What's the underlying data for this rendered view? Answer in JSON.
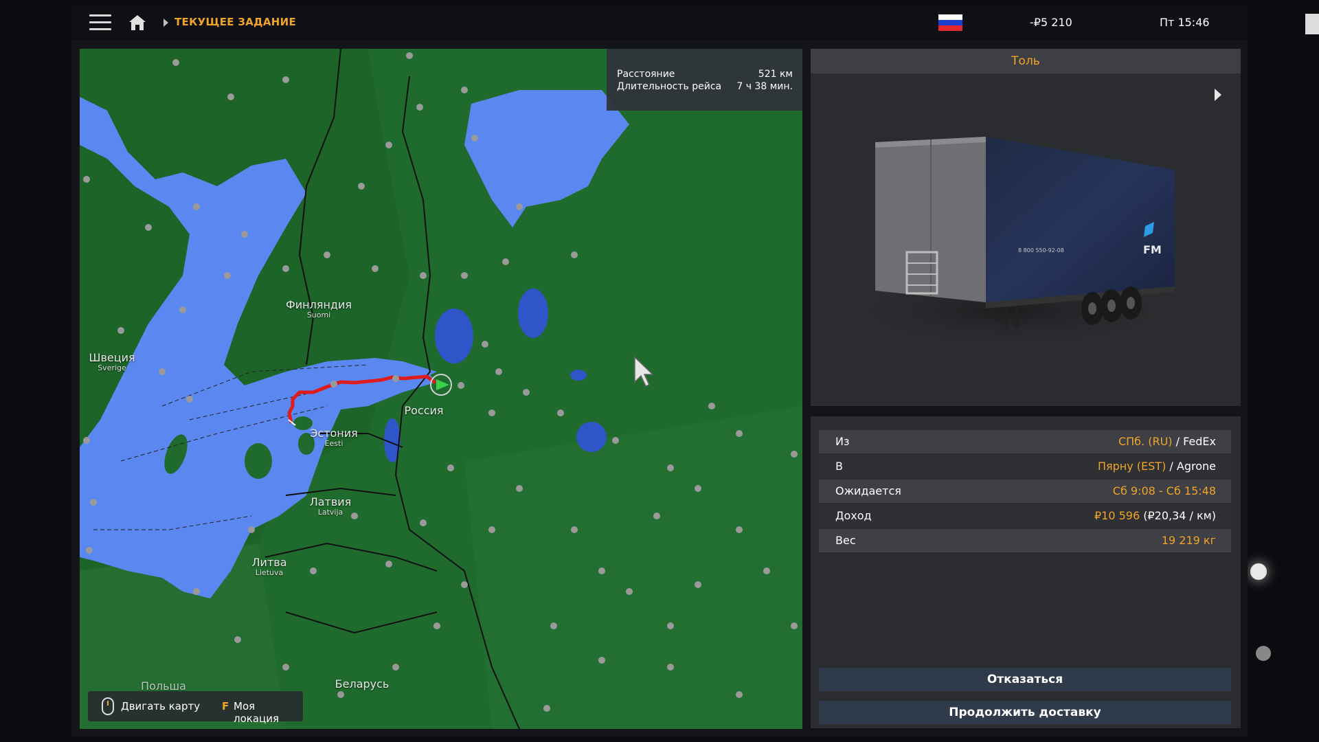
{
  "topbar": {
    "breadcrumb": "ТЕКУЩЕЕ ЗАДАНИЕ",
    "money": "-₽5 210",
    "clock": "Пт 15:46",
    "flag": {
      "colors": [
        "#ffffff",
        "#1c3fd1",
        "#e3262b"
      ]
    }
  },
  "route_info": {
    "distance_label": "Расстояние",
    "distance_value": "521 км",
    "duration_label": "Длительность рейса",
    "duration_value": "7 ч 38 мин."
  },
  "map": {
    "labels": {
      "finland": {
        "name": "Финляндия",
        "native": "Suomi"
      },
      "sweden": {
        "name": "Швеция",
        "native": "Sverige"
      },
      "estonia": {
        "name": "Эстония",
        "native": "Eesti"
      },
      "latvia": {
        "name": "Латвия",
        "native": "Latvija"
      },
      "lithuania": {
        "name": "Литва",
        "native": "Lietuva"
      },
      "russia": {
        "name": "Россия"
      },
      "belarus": {
        "name": "Беларусь"
      },
      "poland": {
        "name": "Польша"
      }
    },
    "colors": {
      "land": "#1f6b2d",
      "water": "#5b87f0",
      "route": "#e01b1b",
      "city": "#9a9a9a"
    }
  },
  "map_controls": {
    "move_label": "Двигать карту",
    "key": "F",
    "location_label": "Моя локация"
  },
  "cargo": {
    "title": "Толь",
    "trailer_text": [
      "8 800 550-92-08",
      "FM"
    ]
  },
  "details": [
    {
      "label": "Из",
      "highlight": "СПб. (RU)",
      "rest": " / FedEx"
    },
    {
      "label": "В",
      "highlight": "Пярну (EST)",
      "rest": " / Agrone"
    },
    {
      "label": "Ожидается",
      "highlight": "Сб 9:08 - Сб 15:48",
      "rest": ""
    },
    {
      "label": "Доход",
      "highlight": "₽10 596",
      "rest": " (₽20,34 / км)"
    },
    {
      "label": "Вес",
      "highlight": "19 219 кг",
      "rest": ""
    }
  ],
  "buttons": {
    "decline": "Отказаться",
    "continue": "Продолжить доставку"
  },
  "accent_color": "#f1a42a"
}
